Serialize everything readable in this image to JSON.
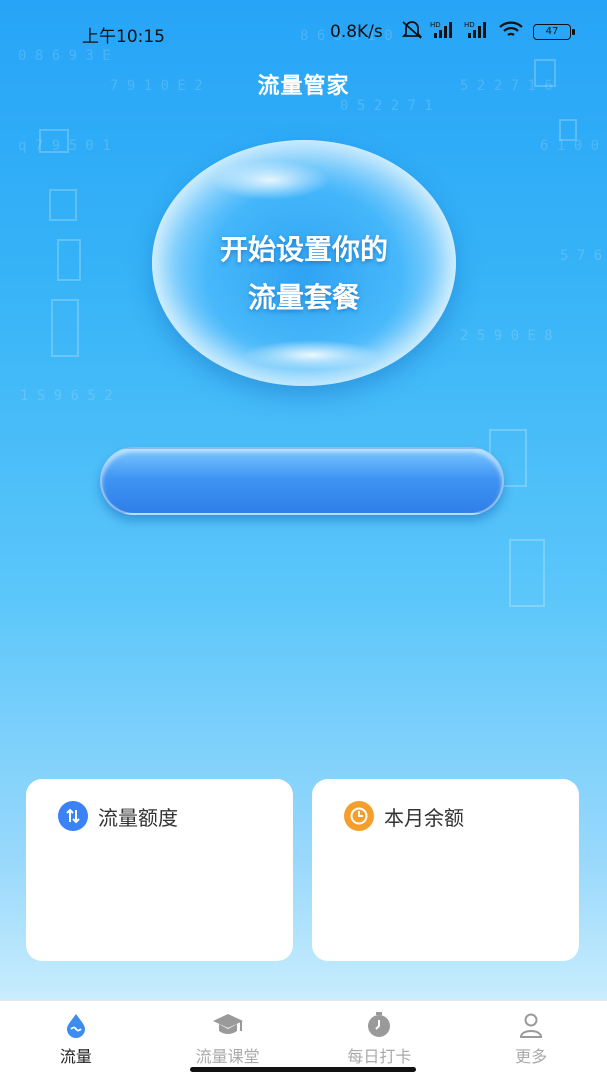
{
  "status_bar": {
    "time": "上午10:15",
    "speed": "0.8K/s",
    "battery": "47",
    "icons": [
      "mute-icon",
      "signal-hd-icon",
      "signal-hd-icon",
      "wifi-icon",
      "battery-icon"
    ]
  },
  "header": {
    "title": "流量管家"
  },
  "bubble": {
    "line1": "开始设置你的",
    "line2": "流量套餐"
  },
  "cards": {
    "quota": {
      "title": "流量额度",
      "icon": "data-arrows-icon",
      "icon_color": "#3b82f6"
    },
    "balance": {
      "title": "本月余额",
      "icon": "clock-icon",
      "icon_color": "#f59e2b"
    }
  },
  "tabbar": {
    "items": [
      {
        "label": "流量",
        "icon": "water-drop-icon",
        "active": true
      },
      {
        "label": "流量课堂",
        "icon": "graduation-cap-icon",
        "active": false
      },
      {
        "label": "每日打卡",
        "icon": "stopwatch-icon",
        "active": false
      },
      {
        "label": "更多",
        "icon": "person-icon",
        "active": false
      }
    ]
  },
  "colors": {
    "accent": "#2f7ee8",
    "background_top": "#27a4f7",
    "active_tab": "#222222",
    "inactive_tab": "#aaaaaa"
  }
}
